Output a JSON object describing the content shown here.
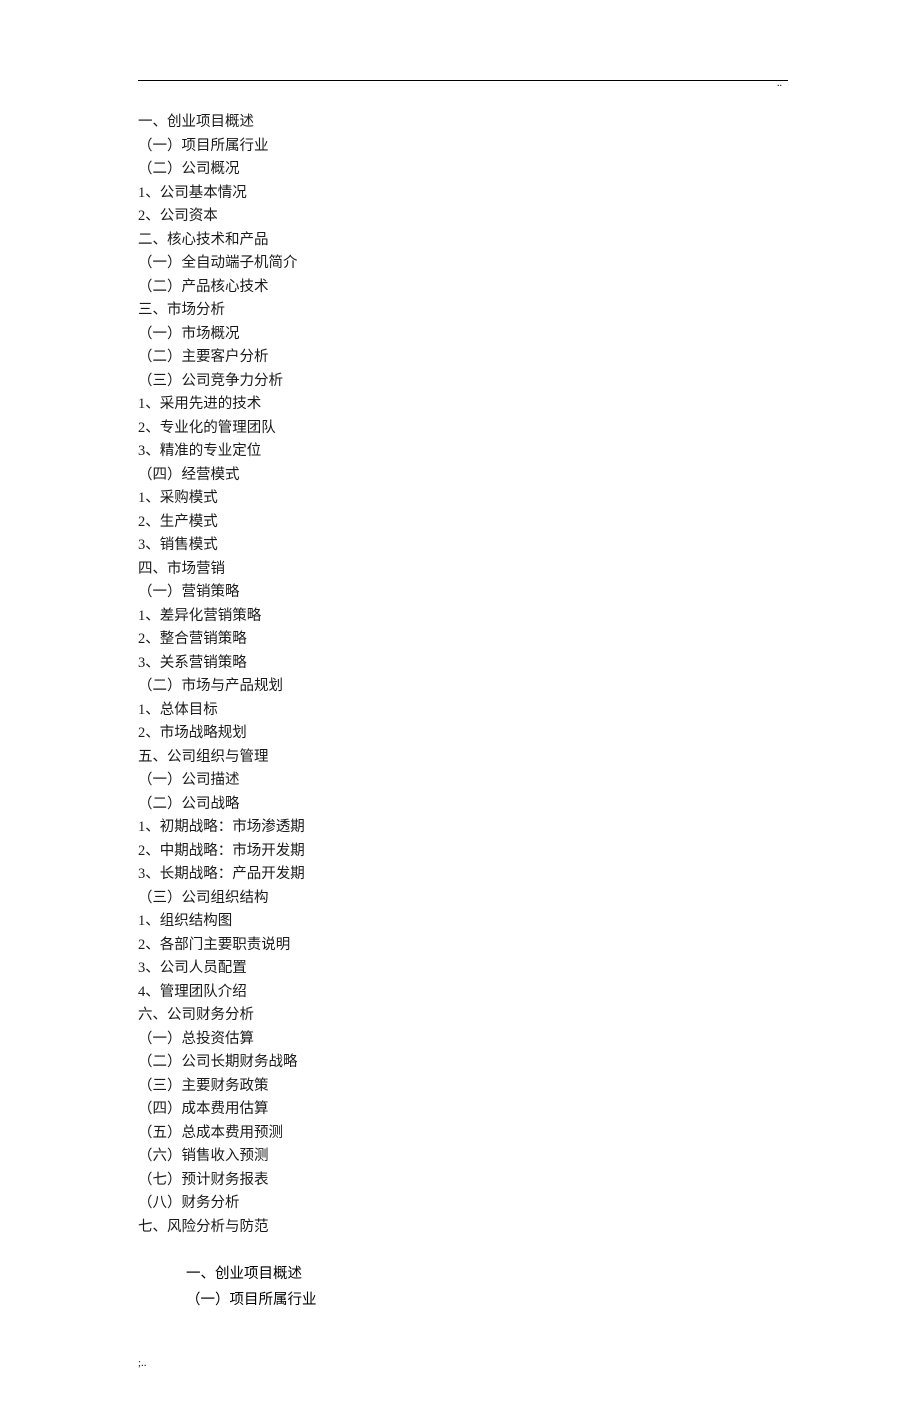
{
  "header": {
    "corner_marks": ".."
  },
  "toc": {
    "items": [
      "一、创业项目概述",
      "（一）项目所属行业",
      "（二）公司概况",
      "1、公司基本情况",
      "2、公司资本",
      "二、核心技术和产品",
      "（一）全自动端子机简介",
      "（二）产品核心技术",
      "三、市场分析",
      "（一）市场概况",
      "（二）主要客户分析",
      "（三）公司竞争力分析",
      "1、采用先进的技术",
      "2、专业化的管理团队",
      "3、精准的专业定位",
      "（四）经营模式",
      "1、采购模式",
      "2、生产模式",
      "3、销售模式",
      "四、市场营销",
      "（一）营销策略",
      "1、差异化营销策略",
      "2、整合营销策略",
      "3、关系营销策略",
      "（二）市场与产品规划",
      "1、总体目标",
      "2、市场战略规划",
      "五、公司组织与管理",
      "（一）公司描述",
      "（二）公司战略",
      "1、初期战略：市场渗透期",
      "2、中期战略：市场开发期",
      "3、长期战略：产品开发期",
      "（三）公司组织结构",
      "1、组织结构图",
      "2、各部门主要职责说明",
      "3、公司人员配置",
      "4、管理团队介绍",
      "六、公司财务分析",
      "（一）总投资估算",
      "（二）公司长期财务战略",
      "（三）主要财务政策",
      "（四）成本费用估算",
      "（五）总成本费用预测",
      "（六）销售收入预测",
      "（七）预计财务报表",
      "（八）财务分析",
      "七、风险分析与防范"
    ]
  },
  "body": {
    "lines": [
      "一、创业项目概述",
      "（一）项目所属行业"
    ]
  },
  "footer": {
    "text": ";.."
  }
}
